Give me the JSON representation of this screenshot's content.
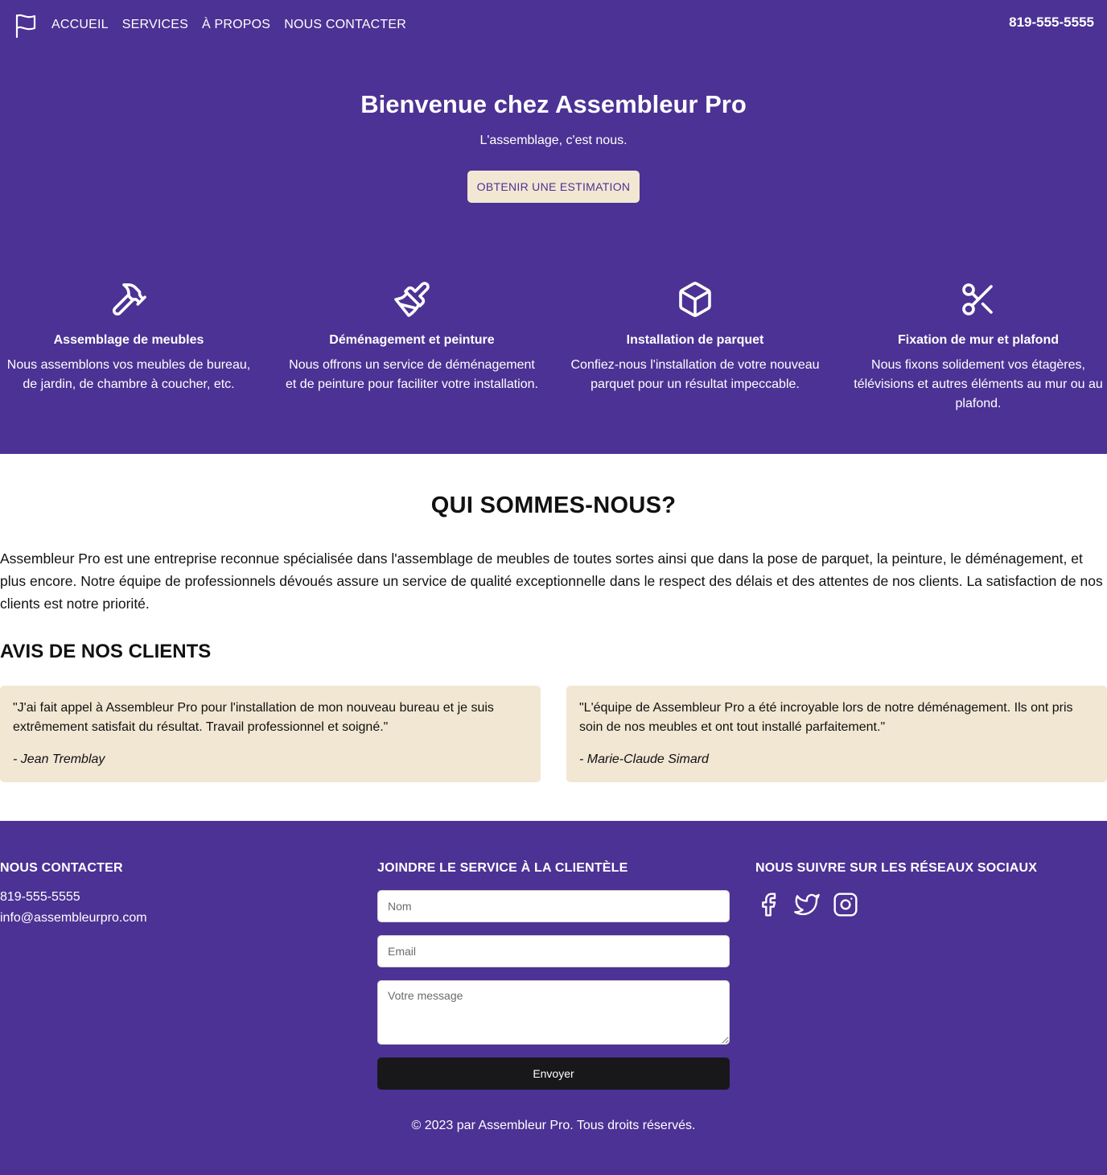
{
  "nav": {
    "logo_icon": "flag-icon",
    "links": [
      "ACCUEIL",
      "SERVICES",
      "À PROPOS",
      "NOUS CONTACTER"
    ],
    "phone": "819-555-5555"
  },
  "hero": {
    "title": "Bienvenue chez Assembleur Pro",
    "tagline": "L'assemblage, c'est nous.",
    "cta": "OBTENIR UNE ESTIMATION"
  },
  "services": [
    {
      "icon": "hammer-icon",
      "title": "Assemblage de meubles",
      "text": "Nous assemblons vos meubles de bureau, de jardin, de chambre à coucher, etc."
    },
    {
      "icon": "paintbrush-icon",
      "title": "Déménagement et peinture",
      "text": "Nous offrons un service de déménagement et de peinture pour faciliter votre installation."
    },
    {
      "icon": "box-icon",
      "title": "Installation de parquet",
      "text": "Confiez-nous l'installation de votre nouveau parquet pour un résultat impeccable."
    },
    {
      "icon": "scissors-icon",
      "title": "Fixation de mur et plafond",
      "text": "Nous fixons solidement vos étagères, télévisions et autres éléments au mur ou au plafond."
    }
  ],
  "about": {
    "title": "QUI SOMMES-NOUS?",
    "text": "Assembleur Pro est une entreprise reconnue spécialisée dans l'assemblage de meubles de toutes sortes ainsi que dans la pose de parquet, la peinture, le déménagement, et plus encore. Notre équipe de professionnels dévoués assure un service de qualité exceptionnelle dans le respect des délais et des attentes de nos clients. La satisfaction de nos clients est notre priorité.",
    "reviews_title": "AVIS DE NOS CLIENTS",
    "reviews": [
      {
        "quote": "\"J'ai fait appel à Assembleur Pro pour l'installation de mon nouveau bureau et je suis extrêmement satisfait du résultat. Travail professionnel et soigné.\"",
        "author": "- Jean Tremblay"
      },
      {
        "quote": "\"L'équipe de Assembleur Pro a été incroyable lors de notre déménagement. Ils ont pris soin de nos meubles et ont tout installé parfaitement.\"",
        "author": "- Marie-Claude Simard"
      }
    ]
  },
  "footer": {
    "contact_title": "NOUS CONTACTER",
    "contact_phone": "819-555-5555",
    "contact_email": "info@assembleurpro.com",
    "form_title": "JOINDRE LE SERVICE À LA CLIENTÈLE",
    "name_placeholder": "Nom",
    "email_placeholder": "Email",
    "message_placeholder": "Votre message",
    "send_label": "Envoyer",
    "social_title": "NOUS SUIVRE SUR LES RÉSEAUX SOCIAUX",
    "social_icons": [
      "facebook-icon",
      "twitter-icon",
      "instagram-icon"
    ],
    "copyright": "© 2023 par Assembleur Pro. Tous droits réservés."
  },
  "colors": {
    "brand_purple": "#4c3294",
    "cream": "#f2e7d3",
    "dark_button": "#18181b"
  }
}
